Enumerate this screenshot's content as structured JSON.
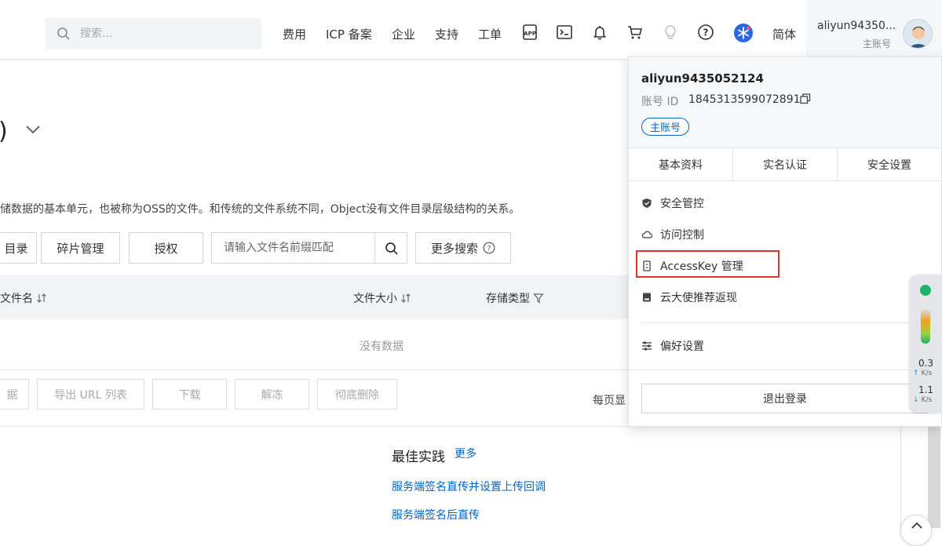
{
  "topbar": {
    "search_placeholder": "搜索...",
    "nav": [
      "费用",
      "ICP 备案",
      "企业",
      "支持",
      "工单"
    ],
    "icons": [
      "app-icon",
      "terminal-icon",
      "bell-icon",
      "cart-icon",
      "lightbulb-icon",
      "help-icon",
      "brand-logo-icon"
    ],
    "lang": "简体",
    "account_name": "aliyun94350...",
    "account_type": "主账号"
  },
  "main": {
    "title_paren": ")",
    "description": "储数据的基本单元，也被称为OSS的文件。和传统的文件系统不同，Object没有文件目录层级结构的关系。",
    "buttons": [
      "目录",
      "碎片管理",
      "授权"
    ],
    "file_search_placeholder": "请输入文件名前缀匹配",
    "more_search": "更多搜索",
    "columns": [
      "文件名",
      "文件大小",
      "存储类型"
    ],
    "empty": "没有数据",
    "batch_buttons": [
      "据",
      "导出 URL 列表",
      "下载",
      "解冻",
      "彻底删除"
    ],
    "per_page": "每页显",
    "best_practice_title": "最佳实践",
    "best_practice_more": "更多",
    "best_practice_links": [
      "服务端签名直传并设置上传回调",
      "服务端签名后直传"
    ]
  },
  "dropdown": {
    "username": "aliyun9435052124",
    "id_label": "账号 ID",
    "id_value": "1845313599072891",
    "badge": "主账号",
    "tabs": [
      "基本资料",
      "实名认证",
      "安全设置"
    ],
    "items": [
      {
        "label": "安全管控",
        "icon": "shield-icon"
      },
      {
        "label": "访问控制",
        "icon": "cloud-icon"
      },
      {
        "label": "AccessKey 管理",
        "icon": "key-icon"
      },
      {
        "label": "云大使推荐返现",
        "icon": "book-icon"
      },
      {
        "label": "偏好设置",
        "icon": "sliders-icon"
      }
    ],
    "logout": "退出登录"
  },
  "speed_widget": {
    "up_value": "0.3",
    "up_unit": "K/s",
    "down_value": "1.1",
    "down_unit": "K/s"
  },
  "colors": {
    "accent": "#0064c8",
    "highlight": "#e0312f"
  }
}
